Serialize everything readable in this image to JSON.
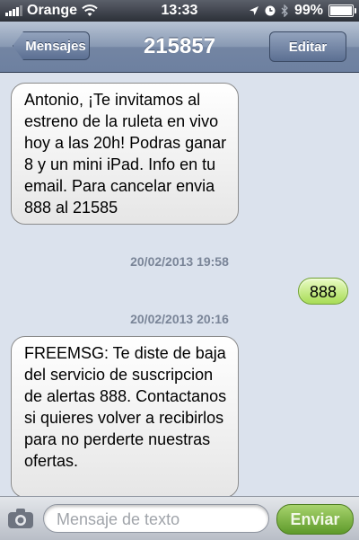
{
  "status_bar": {
    "carrier": "Orange",
    "time": "13:33",
    "battery": "99%",
    "battery_level": 0.99,
    "icons": [
      "signal-icon",
      "wifi-icon",
      "location-arrow-icon",
      "alarm-icon",
      "bluetooth-icon",
      "battery-icon"
    ]
  },
  "nav": {
    "back_label": "Mensajes",
    "title": "215857",
    "edit_label": "Editar"
  },
  "messages": [
    {
      "direction": "incoming",
      "text": "Antonio, ¡Te invitamos al estreno de la ruleta en vivo hoy a las 20h! Podras ganar 8 y un mini iPad. Info en tu email. Para cancelar envia 888 al 21585"
    },
    {
      "timestamp": "20/02/2013 19:58"
    },
    {
      "direction": "outgoing",
      "text": "888"
    },
    {
      "timestamp": "20/02/2013 20:16"
    },
    {
      "direction": "incoming",
      "text": "FREEMSG: Te diste de baja del servicio de suscripcion de alertas 888. Contactanos si quieres volver a recibirlos para no perderte nuestras ofertas."
    }
  ],
  "input_bar": {
    "placeholder": "Mensaje de texto",
    "send_label": "Enviar",
    "icons": [
      "camera-icon"
    ]
  },
  "colors": {
    "background": "#dbe2ed",
    "outgoing_bubble": "#a7dc54",
    "send_button": "#5e9a2a",
    "nav_bar": "#7385a3"
  }
}
